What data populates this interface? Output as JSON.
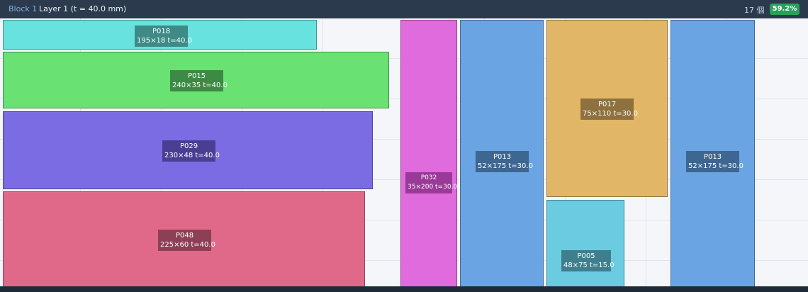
{
  "header": {
    "block_label": "Block 1",
    "layer_label": "Layer 1  (t = 40.0 mm)",
    "count": "17 個",
    "utilization": "59.2%",
    "badge_color": "#26a25a"
  },
  "pieces": [
    {
      "id": "P018",
      "dims": "195×18  t=40.0",
      "color": "#68e2df"
    },
    {
      "id": "P015",
      "dims": "240×35  t=40.0",
      "color": "#69e273"
    },
    {
      "id": "P029",
      "dims": "230×48  t=40.0",
      "color": "#7b6ce3"
    },
    {
      "id": "P048",
      "dims": "225×60  t=40.0",
      "color": "#e0698a"
    },
    {
      "id": "P032",
      "dims": "35×200  t=30.0",
      "color": "#e06bdd"
    },
    {
      "id": "P013",
      "dims": "52×175  t=30.0",
      "color": "#6aa4e3"
    },
    {
      "id": "P017",
      "dims": "75×110  t=30.0",
      "color": "#e1b767"
    },
    {
      "id": "P005",
      "dims": "48×75  t=15.0",
      "color": "#6bcbe1"
    },
    {
      "id": "P013",
      "dims": "52×175  t=30.0",
      "color": "#6aa4e3"
    }
  ]
}
